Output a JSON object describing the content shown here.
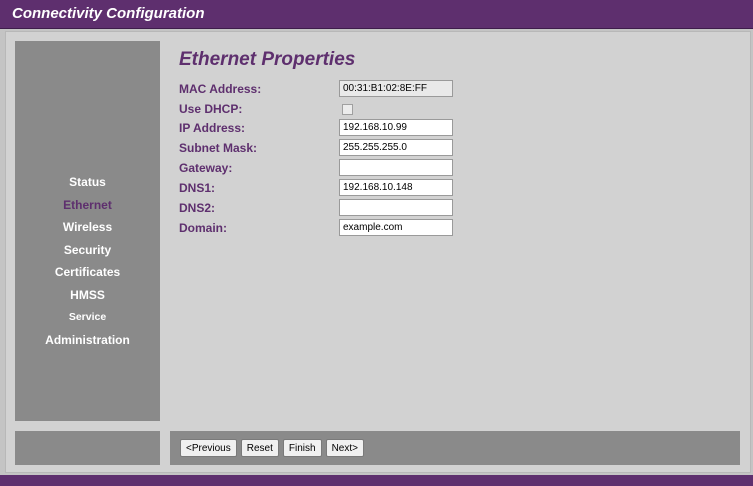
{
  "window": {
    "title": "Connectivity Configuration"
  },
  "sidebar": {
    "items": [
      {
        "label": "Status",
        "active": false
      },
      {
        "label": "Ethernet",
        "active": true
      },
      {
        "label": "Wireless",
        "active": false
      },
      {
        "label": "Security",
        "active": false
      },
      {
        "label": "Certificates",
        "active": false
      },
      {
        "label": "HMSS",
        "active": false
      },
      {
        "label": "Service",
        "active": false
      },
      {
        "label": "Administration",
        "active": false
      }
    ]
  },
  "form": {
    "heading": "Ethernet Properties",
    "mac_label": "MAC Address:",
    "mac_value": "00:31:B1:02:8E:FF",
    "dhcp_label": "Use DHCP:",
    "dhcp_checked": false,
    "ip_label": "IP Address:",
    "ip_value": "192.168.10.99",
    "subnet_label": "Subnet Mask:",
    "subnet_value": "255.255.255.0",
    "gateway_label": "Gateway:",
    "gateway_value": "",
    "dns1_label": "DNS1:",
    "dns1_value": "192.168.10.148",
    "dns2_label": "DNS2:",
    "dns2_value": "",
    "domain_label": "Domain:",
    "domain_value": "example.com"
  },
  "footer": {
    "previous_label": "<Previous",
    "reset_label": "Reset",
    "finish_label": "Finish",
    "next_label": "Next>"
  },
  "colors": {
    "accent": "#5e2f6e",
    "sidebar": "#8a8a8a",
    "background": "#c4c4c4"
  }
}
